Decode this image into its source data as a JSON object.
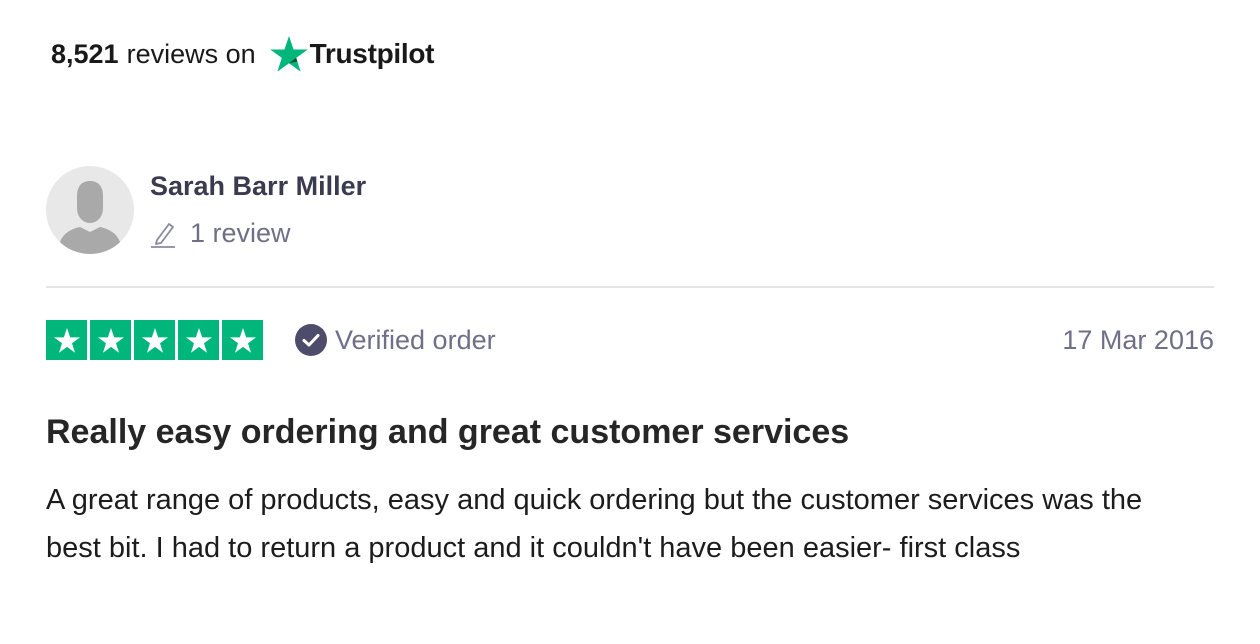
{
  "header": {
    "count": "8,521",
    "text": "reviews on",
    "brand": "Trustpilot",
    "brand_color": "#00b67a"
  },
  "reviewer": {
    "name": "Sarah Barr Miller",
    "review_count": "1 review",
    "avatar_icon": "default-user-icon",
    "meta_icon": "pencil-icon"
  },
  "review": {
    "rating": 5,
    "max_rating": 5,
    "star_color": "#00b67a",
    "verified_label": "Verified order",
    "verified_icon": "check-circle-icon",
    "date": "17 Mar 2016",
    "title": "Really easy ordering and great customer services",
    "body": "A great range of products, easy and quick ordering but the customer services was the best bit. I had to return a product and it couldn't have been easier- first class"
  }
}
